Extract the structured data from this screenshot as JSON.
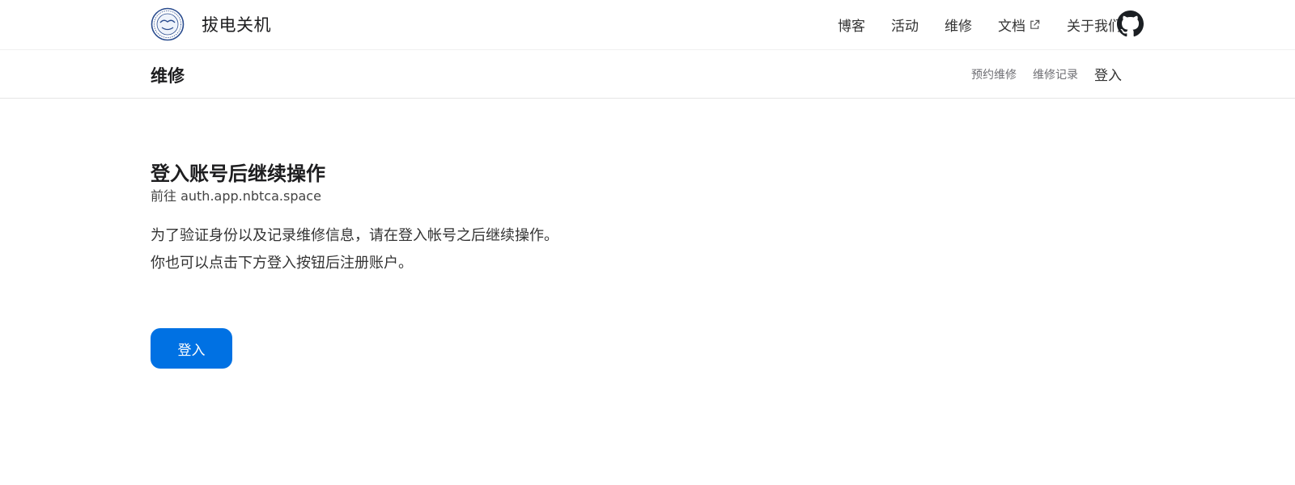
{
  "header": {
    "brand_name": "拔电关机",
    "nav": [
      {
        "label": "博客"
      },
      {
        "label": "活动"
      },
      {
        "label": "维修"
      },
      {
        "label": "文档",
        "icon": "external-link-icon"
      },
      {
        "label": "关于我们"
      }
    ],
    "github_icon": "github-icon"
  },
  "subheader": {
    "title": "维修",
    "links": [
      "预约维修",
      "维修记录"
    ],
    "login_label": "登入"
  },
  "main": {
    "headline": "登入账号后继续操作",
    "subhead": "前往 auth.app.nbtca.space",
    "description_lines": [
      "为了验证身份以及记录维修信息，请在登入帐号之后继续操作。",
      "你也可以点击下方登入按钮后注册账户。"
    ],
    "login_button": "登入"
  },
  "colors": {
    "accent": "#0071e3",
    "text": "#1d1d1f",
    "muted": "#6e6e73"
  }
}
